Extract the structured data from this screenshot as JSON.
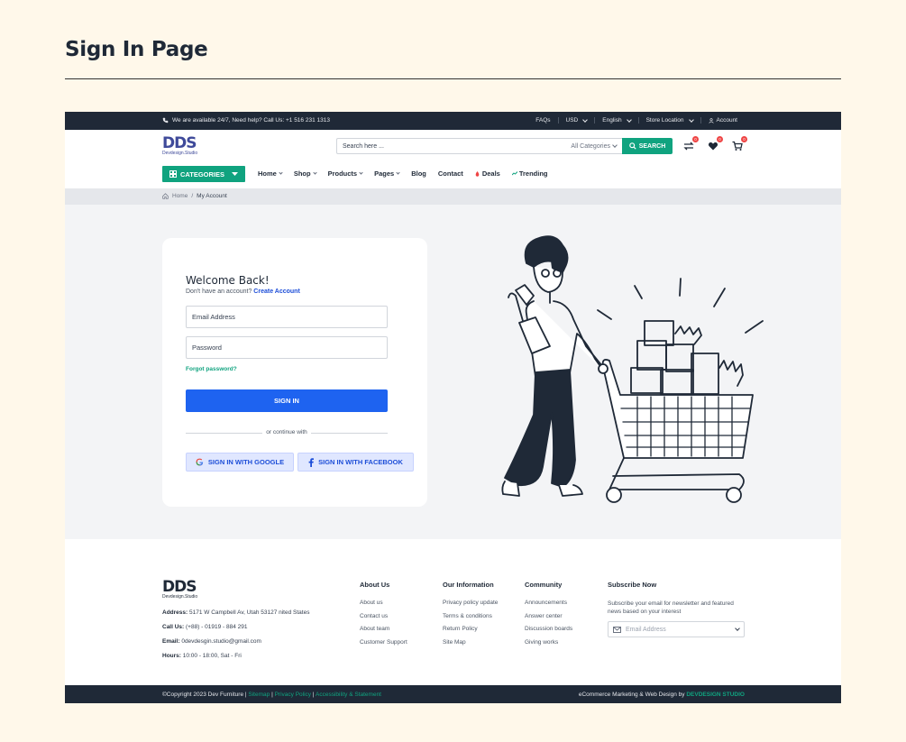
{
  "page": {
    "title": "Sign In Page"
  },
  "topbar": {
    "contact": "We are available 24/7, Need help? Call Us: +1 516 231 1313",
    "faqs": "FAQs",
    "currency": "USD",
    "language": "English",
    "store_location": "Store Location",
    "account": "Account"
  },
  "header": {
    "logo_mark": "DDS",
    "logo_sub": "Devdesign.Studio",
    "search_placeholder": "Search here ...",
    "search_category": "All Categories",
    "search_button": "SEARCH",
    "badges": {
      "compare": "0",
      "wishlist": "0",
      "cart": "0"
    }
  },
  "nav": {
    "categories": "CATEGORIES",
    "links": [
      "Home",
      "Shop",
      "Products",
      "Pages",
      "Blog",
      "Contact",
      "Deals",
      "Trending"
    ]
  },
  "breadcrumb": {
    "home": "Home",
    "separator": "/",
    "current": "My Account"
  },
  "login": {
    "heading": "Welcome Back!",
    "no_account": "Don't have an account?",
    "create_account": "Create Account",
    "email_placeholder": "Email Address",
    "password_placeholder": "Password",
    "forgot": "Forgot password?",
    "signin": "SIGN IN",
    "continue_with": "or continue with",
    "google": "SIGN IN WITH GOOGLE",
    "facebook": "SIGN IN WITH FACEBOOK"
  },
  "footer": {
    "address_label": "Address:",
    "address": "5171 W Campbell Av, Utah 53127 nited States",
    "call_label": "Call Us:",
    "call": "(+88) - 01919 - 884 291",
    "email_label": "Email:",
    "email": "0devdesgin.studio@gmail.com",
    "hours_label": "Hours:",
    "hours": "10:00 - 18:00, Sat - Fri",
    "columns": [
      {
        "title": "About Us",
        "items": [
          "About us",
          "Contact us",
          "About team",
          "Customer Support"
        ]
      },
      {
        "title": "Our Information",
        "items": [
          "Privacy policy update",
          "Terms & conditions",
          "Return Policy",
          "Site Map"
        ]
      },
      {
        "title": "Community",
        "items": [
          "Announcements",
          "Answer center",
          "Discussion boards",
          "Giving works"
        ]
      }
    ],
    "subscribe_title": "Subscribe Now",
    "subscribe_text": "Subscribe your email for newsletter and featured news based on your interest",
    "subscribe_placeholder": "Email Address",
    "copyright": "©Copyright 2023  Dev Furniture",
    "sep": "|",
    "sitemap": "Sitemap",
    "privacy": "Privacy Policy",
    "accessibility": "Accessibility & Statement",
    "credit": "eCommerce Marketing & Web Design by",
    "credit_brand": "DEVDESIGN STUDIO"
  },
  "colors": {
    "accent": "#10a37f",
    "primary": "#1e63f0",
    "dark": "#1f2937",
    "badge": "#ef4444"
  }
}
